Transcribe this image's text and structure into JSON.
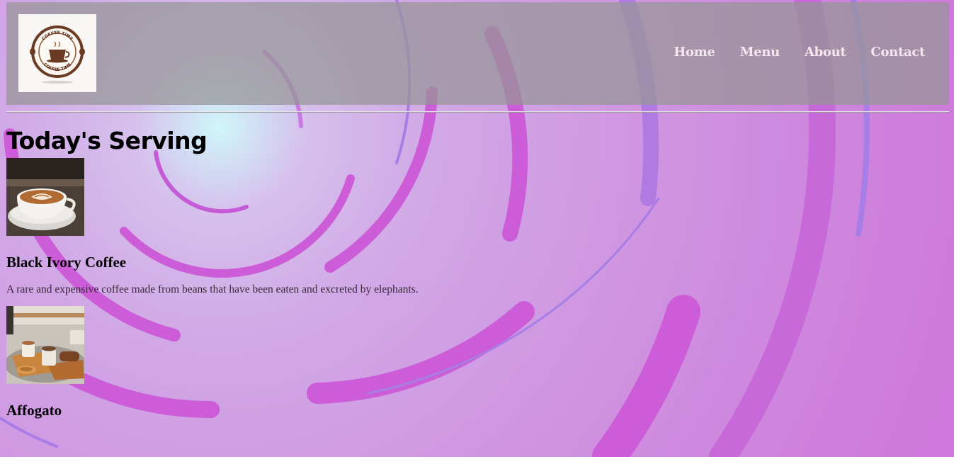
{
  "logo": {
    "icon": "coffee-cup-logo",
    "ring_text": "COFFEE TIME"
  },
  "nav": {
    "items": [
      {
        "label": "Home"
      },
      {
        "label": "Menu"
      },
      {
        "label": "About"
      },
      {
        "label": "Contact"
      }
    ]
  },
  "main": {
    "title": "Today's Serving",
    "items": [
      {
        "name": "Black Ivory Coffee",
        "description": "A rare and expensive coffee made from beans that have been eaten and excreted by elephants.",
        "image": "latte-art-cup-photo"
      },
      {
        "name": "Affogato",
        "description": "",
        "image": "coffee-tray-photo"
      }
    ]
  },
  "colors": {
    "header_overlay": "#969696",
    "nav_text": "#f3e6ec",
    "arc_magenta": "#cc5cd8",
    "arc_violet": "#a77ee6"
  }
}
